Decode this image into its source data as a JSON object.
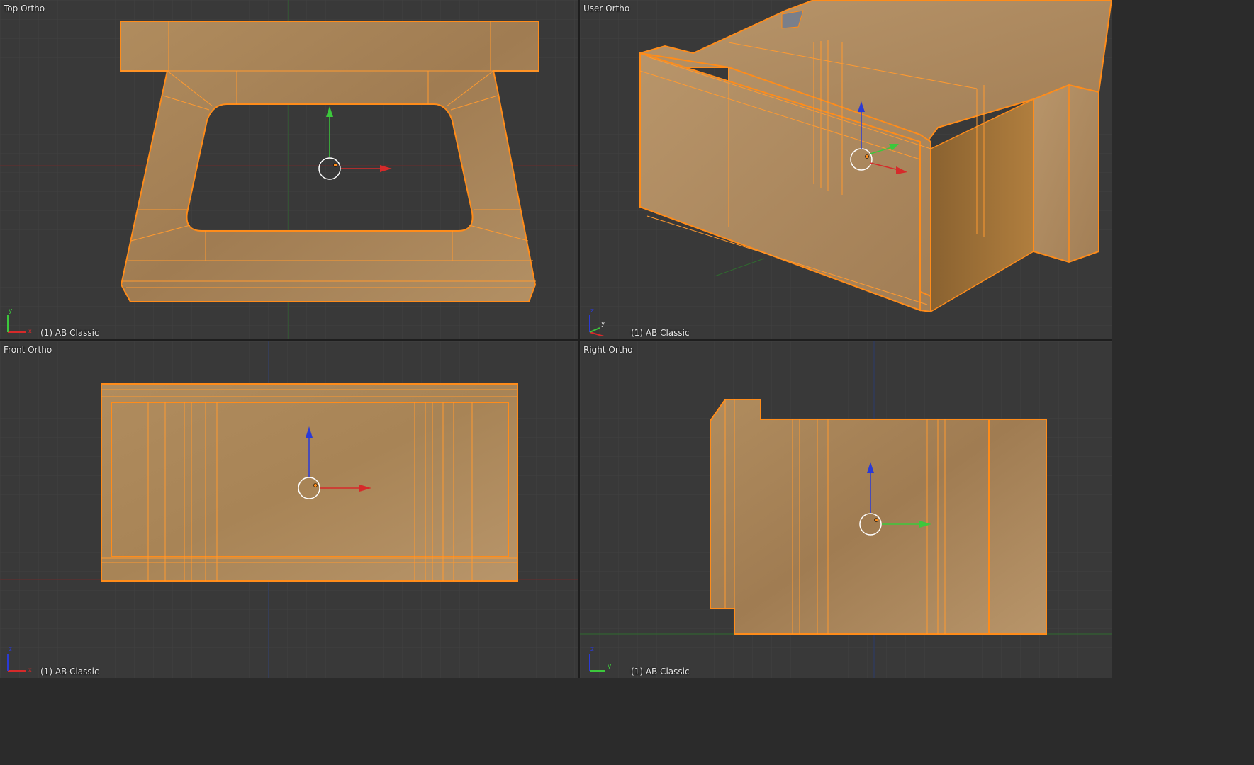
{
  "viewports": {
    "top": {
      "title": "Top Ortho",
      "object_label": "(1) AB Classic",
      "gizmo": {
        "h": "x",
        "v": "y"
      }
    },
    "user": {
      "title": "User Ortho",
      "object_label": "(1) AB Classic",
      "gizmo": {
        "h": "y",
        "v": "z"
      }
    },
    "front": {
      "title": "Front Ortho",
      "object_label": "(1) AB Classic",
      "gizmo": {
        "h": "x",
        "v": "z"
      }
    },
    "right": {
      "title": "Right Ortho",
      "object_label": "(1) AB Classic",
      "gizmo": {
        "h": "y",
        "v": "z"
      }
    }
  },
  "colors": {
    "background": "#393939",
    "grid": "#414141",
    "selection_edge": "#ff8c1a",
    "stone_texture": "#a9855a",
    "axis_x": "#d62a2a",
    "axis_y": "#3cc83c",
    "axis_z": "#2a3ad6"
  }
}
